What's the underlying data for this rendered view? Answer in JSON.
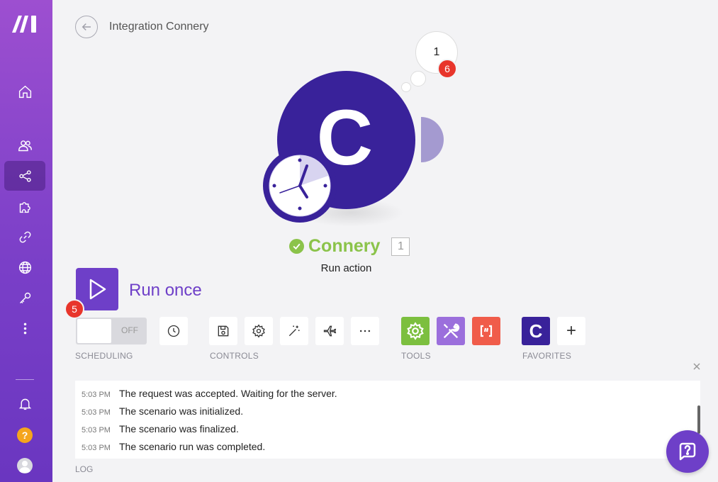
{
  "header": {
    "title": "Integration Connery"
  },
  "sidebar": {
    "items": [
      {
        "icon": "home-icon"
      },
      {
        "icon": "team-icon"
      },
      {
        "icon": "share-icon",
        "active": true
      },
      {
        "icon": "puzzle-icon"
      },
      {
        "icon": "link-icon"
      },
      {
        "icon": "globe-icon"
      },
      {
        "icon": "key-icon"
      },
      {
        "icon": "more-vertical-icon"
      }
    ],
    "help_label": "?"
  },
  "module": {
    "letter": "C",
    "name": "Connery",
    "id": "1",
    "action": "Run action",
    "bubble_count": "1",
    "bubble_badge": "6",
    "status": "success",
    "color": "#39229a"
  },
  "run": {
    "label": "Run once",
    "badge": "5"
  },
  "scheduling": {
    "toggle_label": "OFF",
    "section_label": "SCHEDULING"
  },
  "controls": {
    "section_label": "CONTROLS",
    "buttons": [
      "save-icon",
      "gear-icon",
      "magic-wand-icon",
      "airplane-icon",
      "more-horizontal-icon"
    ]
  },
  "tools": {
    "section_label": "TOOLS",
    "items": [
      {
        "icon": "gear-icon",
        "color": "#7cbf3f"
      },
      {
        "icon": "wrench-icon",
        "color": "#9b6fdc"
      },
      {
        "icon": "brackets-icon",
        "color": "#f05c4a"
      }
    ]
  },
  "favorites": {
    "section_label": "FAVORITES",
    "items": [
      {
        "letter": "C",
        "color": "#39229a"
      }
    ],
    "add_label": "+"
  },
  "log": {
    "label": "LOG",
    "entries": [
      {
        "time": "5:03 PM",
        "message": "The request was accepted. Waiting for the server."
      },
      {
        "time": "5:03 PM",
        "message": "The scenario was initialized."
      },
      {
        "time": "5:03 PM",
        "message": "The scenario was finalized."
      },
      {
        "time": "5:03 PM",
        "message": "The scenario run was completed."
      }
    ]
  },
  "colors": {
    "accent": "#6e3fc8",
    "success": "#8bc34a",
    "badge": "#e8352b",
    "module": "#39229a"
  }
}
